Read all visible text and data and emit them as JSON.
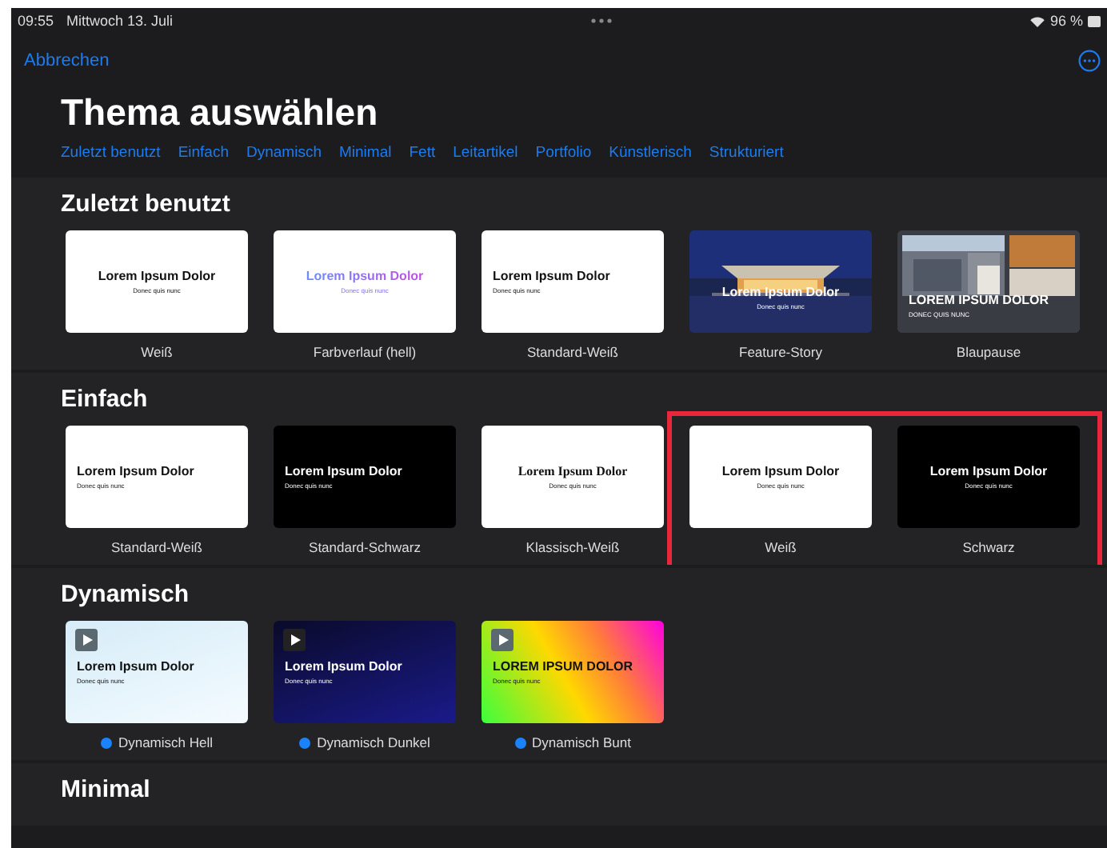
{
  "status_bar": {
    "time": "09:55",
    "date": "Mittwoch 13. Juli",
    "battery": "96 %"
  },
  "nav": {
    "cancel": "Abbrechen"
  },
  "title": "Thema auswählen",
  "categories": [
    "Zuletzt benutzt",
    "Einfach",
    "Dynamisch",
    "Minimal",
    "Fett",
    "Leitartikel",
    "Portfolio",
    "Künstlerisch",
    "Strukturiert"
  ],
  "sections": [
    {
      "heading": "Zuletzt benutzt",
      "themes": [
        {
          "label": "Weiß",
          "kind": "white",
          "title": "Lorem Ipsum Dolor",
          "subtitle": "Donec quis nunc",
          "highlighted": false
        },
        {
          "label": "Farbverlauf (hell)",
          "kind": "gradient",
          "title": "Lorem Ipsum Dolor",
          "subtitle": "Donec quis nunc",
          "highlighted": false
        },
        {
          "label": "Standard-Weiß",
          "kind": "standard-white",
          "title": "Lorem Ipsum Dolor",
          "subtitle": "Donec quis nunc",
          "highlighted": false
        },
        {
          "label": "Feature-Story",
          "title": "Lorem Ipsum Dolor",
          "subtitle": "Donec quis nunc",
          "highlighted": false
        },
        {
          "label": "Blaupause",
          "kind": "blueprint",
          "title": "LOREM IPSUM DOLOR",
          "subtitle": "DONEC QUIS NUNC",
          "highlighted": false
        }
      ]
    },
    {
      "heading": "Einfach",
      "themes": [
        {
          "label": "Standard-Weiß",
          "kind": "standard-white",
          "title": "Lorem Ipsum Dolor",
          "subtitle": "Donec quis nunc",
          "highlighted": false
        },
        {
          "label": "Standard-Schwarz",
          "kind": "standard-black",
          "title": "Lorem Ipsum Dolor",
          "subtitle": "Donec quis nunc",
          "highlighted": false
        },
        {
          "label": "Klassisch-Weiß",
          "kind": "classic",
          "title": "Lorem Ipsum Dolor",
          "subtitle": "Donec quis nunc",
          "highlighted": false
        },
        {
          "label": "Weiß",
          "kind": "white",
          "title": "Lorem Ipsum Dolor",
          "subtitle": "Donec quis nunc",
          "highlighted": true
        },
        {
          "label": "Schwarz",
          "kind": "black",
          "title": "Lorem Ipsum Dolor",
          "subtitle": "Donec quis nunc",
          "highlighted": true
        }
      ]
    },
    {
      "heading": "Dynamisch",
      "themes": [
        {
          "label": "Dynamisch Hell",
          "kind": "dynamic-light",
          "title": "Lorem Ipsum Dolor",
          "subtitle": "Donec quis nunc",
          "highlighted": false,
          "color": "#1a82fb"
        },
        {
          "label": "Dynamisch Dunkel",
          "kind": "dynamic-dark",
          "title": "Lorem Ipsum Dolor",
          "subtitle": "Donec quis nunc",
          "highlighted": false,
          "color": "#1a82fb"
        },
        {
          "label": "Dynamisch Bunt",
          "kind": "dynamic-color",
          "title": "LOREM IPSUM DOLOR",
          "subtitle": "Donec quis nunc",
          "highlighted": false,
          "color": "#1a82fb"
        }
      ]
    },
    {
      "heading": "Minimal"
    }
  ]
}
